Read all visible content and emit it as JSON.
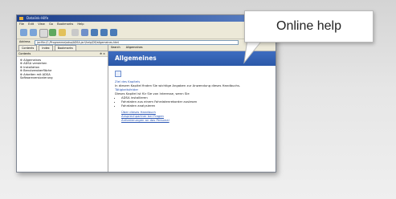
{
  "window": {
    "title": "Datalink-Hilfe",
    "menu": [
      "File",
      "Edit",
      "View",
      "Go",
      "Bookmarks",
      "Help"
    ],
    "address_label": "Address",
    "address_value": "jar:file:/C:/Programme/adsa/ADSA.jar!/help/DE/allgemeines.html"
  },
  "left_pane": {
    "tabs": [
      "Contents",
      "Index",
      "Bookmarks"
    ],
    "header": "Contents",
    "pin": "⊕ ×",
    "tree": [
      "⊕ Allgemeines",
      "⊕ ADSA verstehen",
      "⊕ Installation",
      "⊕ Benutzeroberfläche",
      "⊕ Arbeiten mit ADSA",
      "   Softwareversionierung"
    ]
  },
  "right_pane": {
    "toolbar": [
      "Search",
      "Allgemeines"
    ],
    "banner": "Allgemeines",
    "goal_heading": "Ziel des Kapitels",
    "goal_text": "In diesem Kapitel finden Sie wichtige Angaben zur Anwendung dieses Handbuchs.",
    "section_heading": "Tätigkeitsfelder",
    "intro": "Dieses Kapitel ist für Sie von Interesse, wenn Sie",
    "bullets": [
      "ADSA installieren",
      "Fahrdaten aus einem Fahrdatenrekorder auslesen",
      "Fahrdaten analysieren"
    ],
    "links": [
      "Über dieses Handbuch",
      "Ansprechpartner bei Fragen",
      "Anforderungen an das Personal"
    ]
  },
  "callout": {
    "text": "Online help"
  },
  "colors": {
    "banner": "#2f5cae",
    "link": "#2a56b5",
    "titlebar": "#1d3f8b"
  }
}
